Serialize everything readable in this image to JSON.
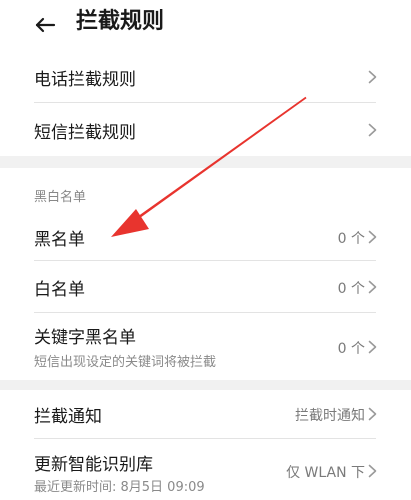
{
  "header": {
    "title": "拦截规则",
    "back_icon": "arrow-left-icon"
  },
  "rules": {
    "items": [
      {
        "label": "电话拦截规则"
      },
      {
        "label": "短信拦截规则"
      }
    ]
  },
  "list_section": {
    "header": "黑白名单",
    "items": [
      {
        "label": "黑名单",
        "value": "0 个"
      },
      {
        "label": "白名单",
        "value": "0 个"
      },
      {
        "label": "关键字黑名单",
        "subtitle": "短信出现设定的关键词将被拦截",
        "value": "0 个"
      }
    ]
  },
  "notify_section": {
    "items": [
      {
        "label": "拦截通知",
        "value": "拦截时通知"
      },
      {
        "label": "更新智能识别库",
        "subtitle": "最近更新时间: 8月5日 09:09",
        "value": "仅 WLAN 下"
      }
    ]
  },
  "annotation": {
    "arrow_color": "#e8342e",
    "points_to": "黑名单"
  },
  "icons": {
    "chevron": "chevron-right-icon"
  }
}
